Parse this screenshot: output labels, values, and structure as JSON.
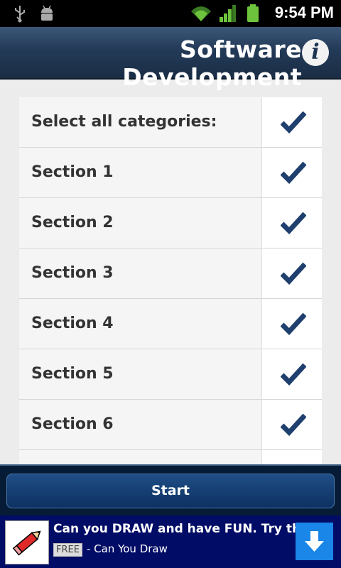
{
  "status_bar": {
    "time": "9:54 PM"
  },
  "header": {
    "title": "Software Development"
  },
  "list": {
    "items": [
      {
        "label": "Select all categories:",
        "checked": true
      },
      {
        "label": "Section 1",
        "checked": true
      },
      {
        "label": "Section 2",
        "checked": true
      },
      {
        "label": "Section 3",
        "checked": true
      },
      {
        "label": "Section 4",
        "checked": true
      },
      {
        "label": "Section 5",
        "checked": true
      },
      {
        "label": "Section 6",
        "checked": true
      },
      {
        "label": "",
        "checked": true
      }
    ]
  },
  "footer": {
    "start_label": "Start"
  },
  "ad": {
    "title": "Can you DRAW and have FUN. Try this",
    "free_tag": "FREE",
    "subtitle": "- Can You Draw"
  },
  "colors": {
    "accent": "#1f3f6e",
    "header": "#233a57",
    "ad_bg": "#000c66"
  }
}
